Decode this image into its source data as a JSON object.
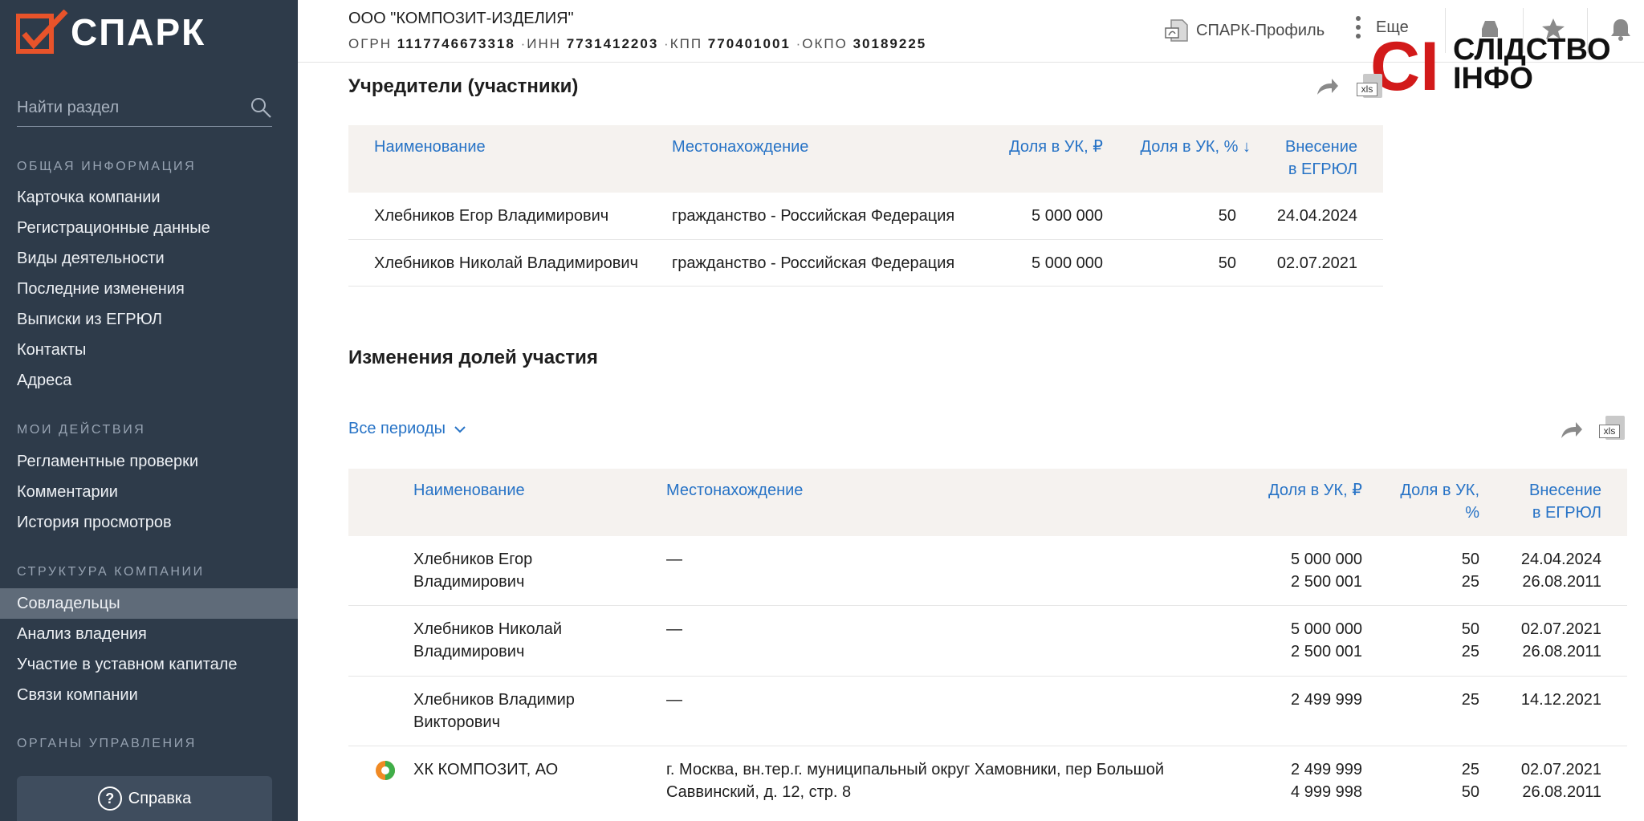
{
  "sidebar": {
    "logo_text": "СПАРК",
    "search_placeholder": "Найти раздел",
    "sections": [
      {
        "title": "ОБЩАЯ ИНФОРМАЦИЯ",
        "items": [
          "Карточка компании",
          "Регистрационные данные",
          "Виды деятельности",
          "Последние изменения",
          "Выписки из ЕГРЮЛ",
          "Контакты",
          "Адреса"
        ]
      },
      {
        "title": "МОИ ДЕЙСТВИЯ",
        "items": [
          "Регламентные проверки",
          "Комментарии",
          "История просмотров"
        ]
      },
      {
        "title": "СТРУКТУРА КОМПАНИИ",
        "items": [
          "Совладельцы",
          "Анализ владения",
          "Участие в уставном капитале",
          "Связи компании"
        ]
      },
      {
        "title": "ОРГАНЫ УПРАВЛЕНИЯ",
        "items": []
      }
    ],
    "active_item": "Совладельцы",
    "help_label": "Справка",
    "help_symbol": "?"
  },
  "header": {
    "company_name": "ООО \"КОМПОЗИТ-ИЗДЕЛИЯ\"",
    "ogrn_label": "ОГРН",
    "ogrn": "1117746673318",
    "inn_label": "ИНН",
    "inn": "7731412203",
    "kpp_label": "КПП",
    "kpp": "770401001",
    "okpo_label": "ОКПО",
    "okpo": "30189225",
    "separator": "·",
    "profile_label": "СПАРК-Профиль",
    "more_label": "Еще"
  },
  "watermark": {
    "mark": "СІ",
    "line1": "СЛІДСТВО",
    "line2": "ІНФО"
  },
  "founders": {
    "title": "Учредители (участники)",
    "columns": [
      "Наименование",
      "Местонахождение",
      "Доля в УК, ₽",
      "Доля в УК, % ↓",
      "Внесение",
      "в ЕГРЮЛ"
    ],
    "rows": [
      {
        "name": "Хлебников Егор Владимирович",
        "location": "гражданство - Российская Федерация",
        "share_rub": "5 000 000",
        "share_pct": "50",
        "date": "24.04.2024"
      },
      {
        "name": "Хлебников Николай Владимирович",
        "location": "гражданство - Российская Федерация",
        "share_rub": "5 000 000",
        "share_pct": "50",
        "date": "02.07.2021"
      }
    ]
  },
  "changes": {
    "title": "Изменения долей участия",
    "period_label": "Все периоды",
    "columns": [
      "Наименование",
      "Местонахождение",
      "Доля в УК, ₽",
      "Доля в УК,",
      "%",
      "Внесение",
      "в ЕГРЮЛ"
    ],
    "rows": [
      {
        "name1": "Хлебников Егор",
        "name2": "Владимирович",
        "loc1": "—",
        "loc2": "",
        "rub1": "5 000 000",
        "rub2": "2 500 001",
        "pct1": "50",
        "pct2": "25",
        "date1": "24.04.2024",
        "date2": "26.08.2011"
      },
      {
        "name1": "Хлебников Николай",
        "name2": "Владимирович",
        "loc1": "—",
        "loc2": "",
        "rub1": "5 000 000",
        "rub2": "2 500 001",
        "pct1": "50",
        "pct2": "25",
        "date1": "02.07.2021",
        "date2": "26.08.2011"
      },
      {
        "name1": "Хлебников Владимир",
        "name2": "Викторович",
        "loc1": "—",
        "loc2": "",
        "rub1": "2 499 999",
        "rub2": "",
        "pct1": "25",
        "pct2": "",
        "date1": "14.12.2021",
        "date2": ""
      },
      {
        "name1": "ХК КОМПОЗИТ, АО",
        "name2": "",
        "loc1": "г. Москва, вн.тер.г. муниципальный округ Хамовники, пер Большой",
        "loc2": "Саввинский, д. 12, стр. 8",
        "rub1": "2 499 999",
        "rub2": "4 999 998",
        "pct1": "25",
        "pct2": "50",
        "date1": "02.07.2021",
        "date2": "26.08.2011"
      }
    ]
  },
  "colors": {
    "sidebar_bg": "#2e3b4a",
    "link": "#2773c6",
    "accent": "#e8532a",
    "table_head_bg": "#f5f2ef",
    "watermark": "#d21a1a"
  }
}
